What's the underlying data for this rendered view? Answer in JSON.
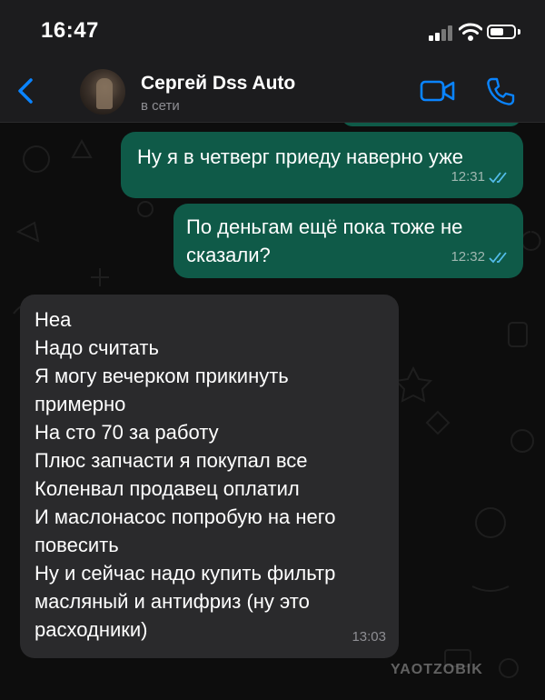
{
  "status_bar": {
    "time": "16:47"
  },
  "header": {
    "contact_name": "Сергей Dss Auto",
    "contact_status": "в сети",
    "accent_color": "#0a84ff"
  },
  "messages": [
    {
      "direction": "outgoing",
      "text": "Ну я в четверг приеду наверно уже",
      "time": "12:31",
      "read": true
    },
    {
      "direction": "outgoing",
      "text": "По деньгам ещё пока тоже не\nсказали?",
      "time": "12:32",
      "read": true
    },
    {
      "direction": "incoming",
      "text": "Неа\nНадо считать\nЯ могу вечерком прикинуть\nпримерно\nНа сто 70 за работу\nПлюс запчасти я покупал все\nКоленвал продавец оплатил\nИ маслонасос попробую на него\nповесить\nНу и сейчас надо купить фильтр\nмасляный и антифриз (ну это\nрасходники)",
      "time": "13:03"
    }
  ],
  "watermark": "YAOTZOBIK",
  "colors": {
    "outgoing_bubble": "#0f5a48",
    "incoming_bubble": "#2a2a2c",
    "read_ticks": "#53bdeb"
  }
}
